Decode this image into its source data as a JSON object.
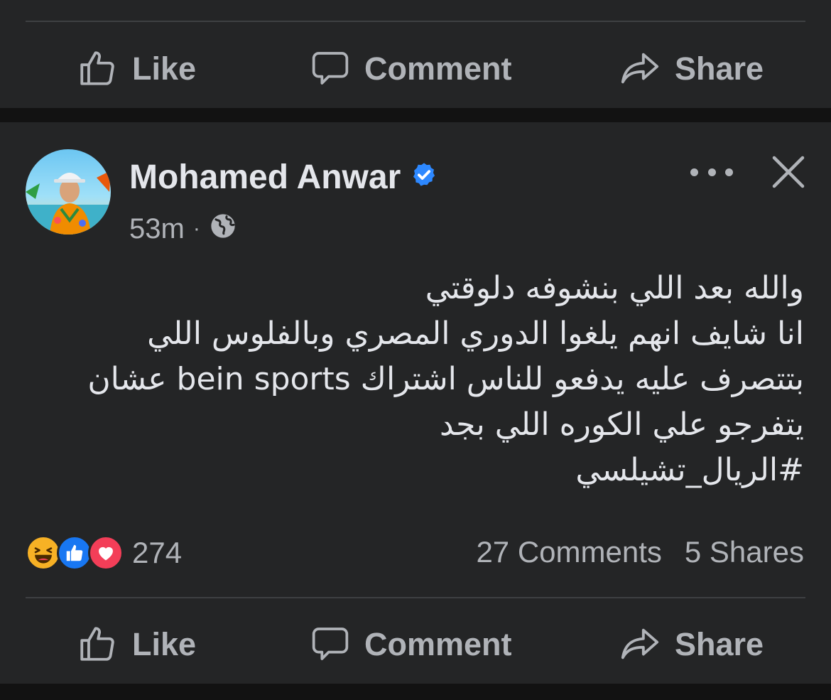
{
  "top_actions": {
    "like": "Like",
    "comment": "Comment",
    "share": "Share"
  },
  "post": {
    "author": "Mohamed Anwar",
    "verified": true,
    "time": "53m",
    "separator": "·",
    "audience_icon": "globe-icon",
    "text": "والله بعد اللي بنشوفه دلوقتي\nانا شايف انهم يلغوا الدوري المصري وبالفلوس اللي \nبتتصرف عليه يدفعو للناس اشتراك bein sports عشان\nيتفرجو علي الكوره اللي بجد\n#الريال_تشيلسي",
    "reactions": {
      "types": [
        "haha",
        "like",
        "love"
      ],
      "count": "274"
    },
    "comments_count": "27 Comments",
    "shares_count": "5 Shares",
    "actions": {
      "like": "Like",
      "comment": "Comment",
      "share": "Share"
    }
  },
  "colors": {
    "background": "#121212",
    "card": "#242526",
    "text_primary": "#e4e6eb",
    "text_secondary": "#b0b3b8",
    "verified": "#2d88ff",
    "like_blue": "#1877f2",
    "love_red": "#f33e58",
    "haha_yellow": "#f7b125"
  }
}
